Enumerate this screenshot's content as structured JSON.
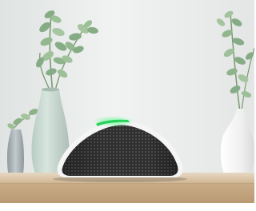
{
  "scene": {
    "subject": "smart-speaker",
    "objects": [
      "smart-speaker",
      "status-light-ring",
      "vase-with-plant-left",
      "small-vase-left",
      "vase-with-plant-right",
      "wooden-shelf"
    ],
    "colors": {
      "wall": "#e9ecec",
      "shelf": "#d7c2a5",
      "speaker_grille": "#3a3a3a",
      "speaker_shell": "#f4f4f4",
      "status_light": "#27d15a",
      "vase_left": "#c7d7cf",
      "vase_right": "#f2f2f2",
      "small_vase": "#aab3b6",
      "leaves": "#86ac86"
    }
  }
}
